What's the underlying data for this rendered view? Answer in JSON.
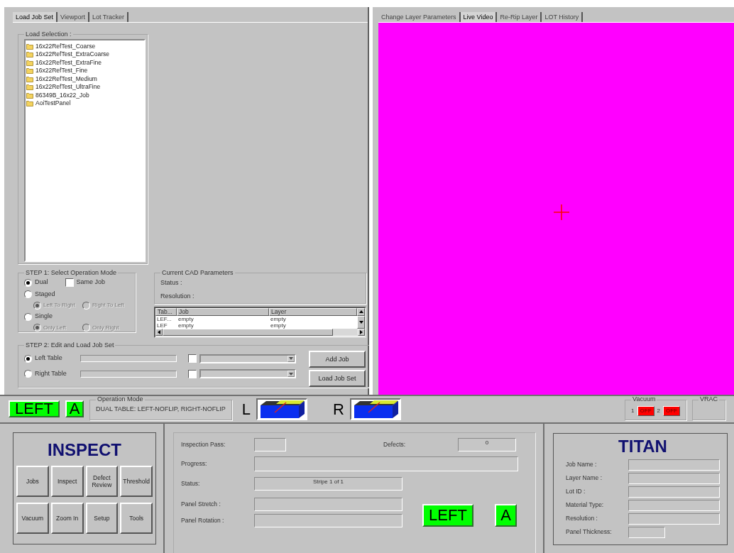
{
  "left_tabs": [
    {
      "label": "Load Job Set",
      "selected": true
    },
    {
      "label": "Viewport",
      "selected": false
    },
    {
      "label": "Lot Tracker",
      "selected": false
    }
  ],
  "load_selection": {
    "label": "Load Selection :",
    "items": [
      "16x22RefTest_Coarse",
      "16x22RefTest_ExtraCoarse",
      "16x22RefTest_ExtraFine",
      "16x22RefTest_Fine",
      "16x22RefTest_Medium",
      "16x22RefTest_UltraFine",
      "86349B_16x22_Job",
      "AoiTestPanel"
    ]
  },
  "step1": {
    "title": "STEP 1: Select Operation Mode",
    "same_job": {
      "label": "Same Job",
      "checked": false
    },
    "modes": [
      {
        "label": "Dual",
        "selected": true
      },
      {
        "label": "Staged",
        "selected": false,
        "suboptions": [
          {
            "label": "Left To Right",
            "selected": true,
            "disabled": true
          },
          {
            "label": "Right To Left",
            "selected": false,
            "disabled": true
          }
        ]
      },
      {
        "label": "Single",
        "selected": false,
        "suboptions": [
          {
            "label": "Only Left",
            "selected": true,
            "disabled": true
          },
          {
            "label": "Only Right",
            "selected": false,
            "disabled": true
          }
        ]
      }
    ]
  },
  "cad_parameters": {
    "title": "Current CAD Parameters",
    "fields": [
      "Status :",
      "Resolution :"
    ]
  },
  "job_table": {
    "columns": [
      "Tab...",
      "Job",
      "Layer"
    ],
    "rows": [
      [
        "LEF...",
        "empty",
        "empty"
      ],
      [
        "LEF",
        "empty",
        "empty"
      ]
    ]
  },
  "step2": {
    "title": "STEP 2: Edit and Load Job Set",
    "tables": [
      {
        "label": "Left Table",
        "selected": true,
        "checked": false
      },
      {
        "label": "Right Table",
        "selected": false,
        "checked": false
      }
    ],
    "buttons": [
      "Add Job",
      "Load Job Set"
    ]
  },
  "right_tabs": [
    {
      "label": "Change Layer Parameters",
      "selected": false
    },
    {
      "label": "Live Video",
      "selected": true
    },
    {
      "label": "Re-Rip Layer",
      "selected": false
    },
    {
      "label": "LOT History",
      "selected": false
    }
  ],
  "status_bar": {
    "table_badge": "LEFT",
    "side_badge": "A",
    "operation_mode": {
      "label": "Operation Mode",
      "value": "DUAL TABLE: LEFT-NOFLIP, RIGHT-NOFLIP"
    },
    "left_label": "L",
    "right_label": "R",
    "vacuum": {
      "label": "Vacuum",
      "items": [
        {
          "number": "1",
          "state": "OFF",
          "on": false
        },
        {
          "number": "2",
          "state": "OFF",
          "on": false
        }
      ]
    },
    "vrac_label": "VRAC"
  },
  "inspect_panel": {
    "title": "INSPECT",
    "buttons": [
      "Jobs",
      "Inspect",
      "Defect Review",
      "Threshold",
      "Vacuum",
      "Zoom In",
      "Setup",
      "Tools"
    ]
  },
  "progress_panel": {
    "inspection_pass": {
      "label": "Inspection Pass:"
    },
    "defects": {
      "label": "Defects:",
      "value": "0"
    },
    "progress": {
      "label": "Progress:"
    },
    "status": {
      "label": "Status:",
      "value": "Stripe 1 of 1"
    },
    "panel_stretch": {
      "label": "Panel Stretch :"
    },
    "panel_rotation": {
      "label": "Panel Rotation :"
    },
    "table_badge": "LEFT",
    "side_badge": "A"
  },
  "titan_panel": {
    "title": "TITAN",
    "fields": [
      {
        "label": "Job Name :"
      },
      {
        "label": "Layer Name :"
      },
      {
        "label": "Lot ID :"
      },
      {
        "label": "Material Type:"
      },
      {
        "label": "Resolution :"
      },
      {
        "label": "Panel Thickness:",
        "short": true
      }
    ]
  }
}
